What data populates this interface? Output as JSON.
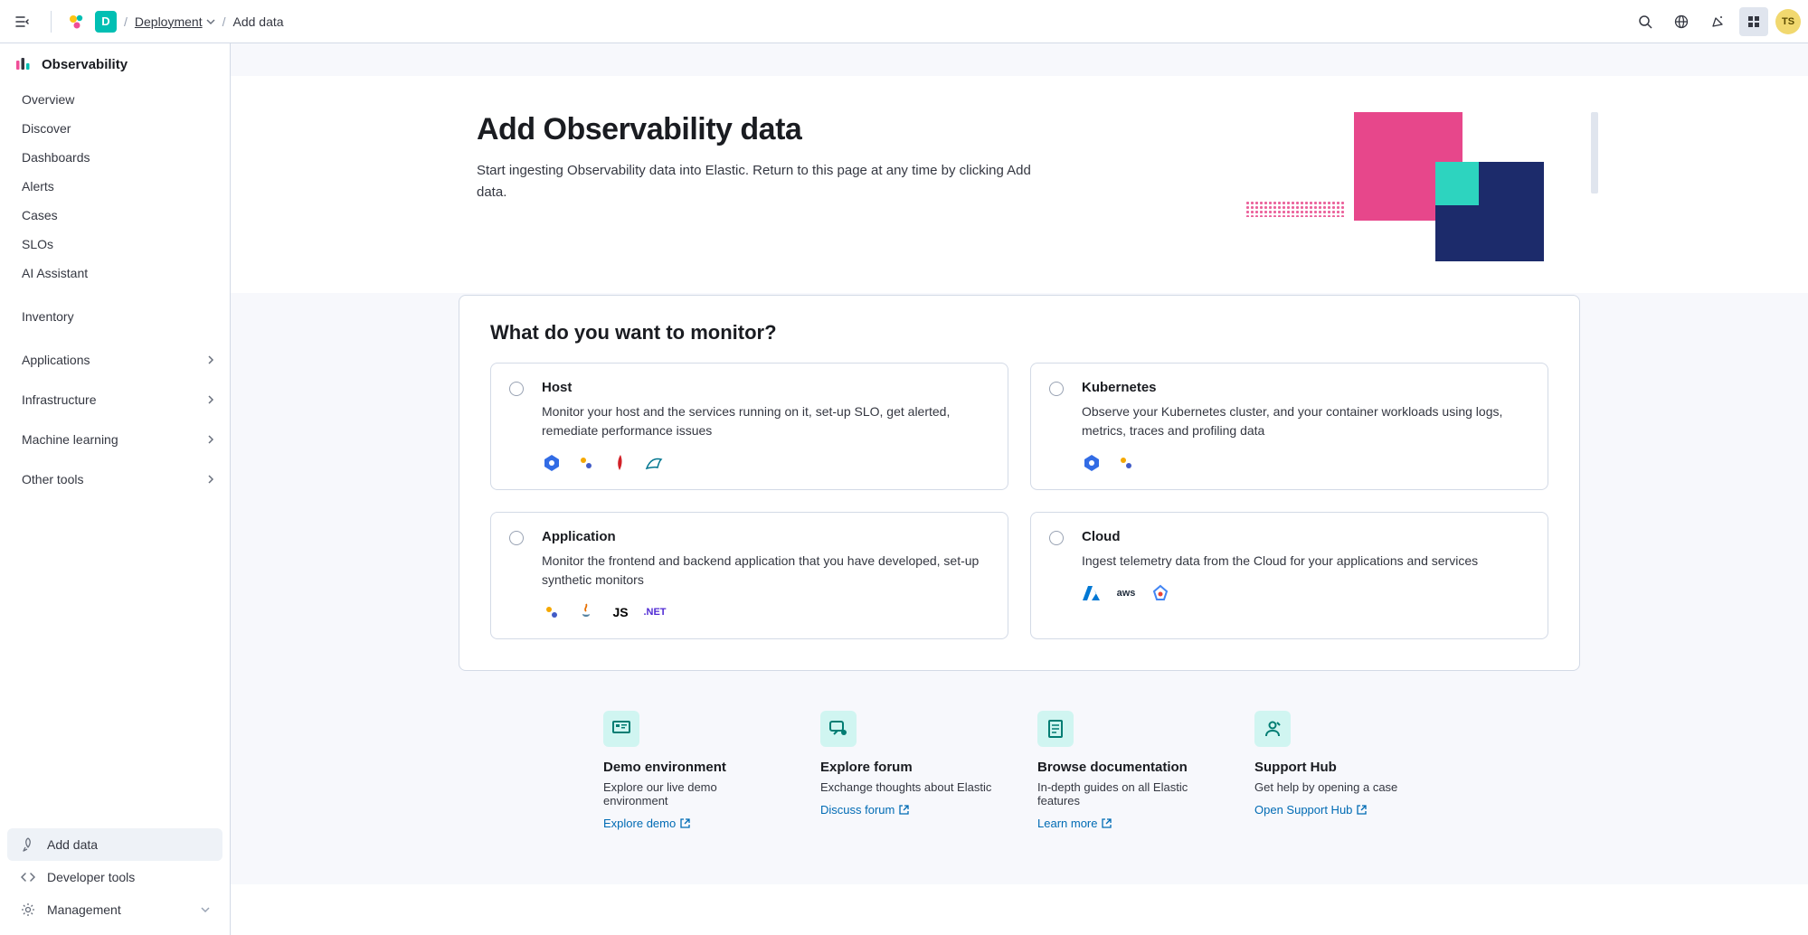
{
  "topbar": {
    "deployment_badge": "D",
    "breadcrumb_link": "Deployment",
    "breadcrumb_current": "Add data",
    "avatar": "TS"
  },
  "sidebar": {
    "header": "Observability",
    "items": [
      "Overview",
      "Discover",
      "Dashboards",
      "Alerts",
      "Cases",
      "SLOs",
      "AI Assistant"
    ],
    "inventory": "Inventory",
    "expand_items": [
      "Applications",
      "Infrastructure",
      "Machine learning",
      "Other tools"
    ],
    "bottom": {
      "add_data": "Add data",
      "dev_tools": "Developer tools",
      "management": "Management"
    }
  },
  "hero": {
    "title": "Add Observability data",
    "subtitle": "Start ingesting Observability data into Elastic. Return to this page at any time by clicking Add data."
  },
  "monitor": {
    "heading": "What do you want to monitor?",
    "cards": [
      {
        "title": "Host",
        "desc": "Monitor your host and the services running on it, set-up SLO, get alerted, remediate performance issues"
      },
      {
        "title": "Kubernetes",
        "desc": "Observe your Kubernetes cluster, and your container workloads using logs, metrics, traces and profiling data"
      },
      {
        "title": "Application",
        "desc": "Monitor the frontend and backend application that you have developed, set-up synthetic monitors"
      },
      {
        "title": "Cloud",
        "desc": "Ingest telemetry data from the Cloud for your applications and services"
      }
    ],
    "app_icons": {
      "js": "JS",
      "dotnet": ".NET"
    },
    "cloud_icons": {
      "aws": "aws"
    }
  },
  "resources": [
    {
      "title": "Demo environment",
      "desc": "Explore our live demo environment",
      "link": "Explore demo"
    },
    {
      "title": "Explore forum",
      "desc": "Exchange thoughts about Elastic",
      "link": "Discuss forum"
    },
    {
      "title": "Browse documentation",
      "desc": "In-depth guides on all Elastic features",
      "link": "Learn more"
    },
    {
      "title": "Support Hub",
      "desc": "Get help by opening a case",
      "link": "Open Support Hub"
    }
  ]
}
